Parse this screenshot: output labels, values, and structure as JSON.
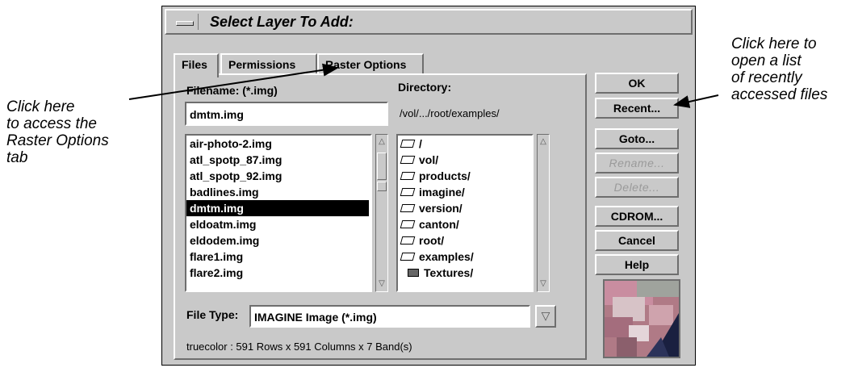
{
  "annotations": {
    "left_lines": [
      "Click here",
      "to access the",
      "Raster Options",
      "tab"
    ],
    "right_lines": [
      "Click here to",
      "open a list",
      "of recently",
      "accessed files"
    ]
  },
  "dialog": {
    "title": "Select Layer To Add:",
    "menu_icon": "window-menu-icon",
    "tabs": [
      "Files",
      "Permissions",
      "Raster Options"
    ],
    "active_tab": "Files",
    "filename_label": "Filename: (*.img)",
    "filename_value": "dmtm.img",
    "directory_label": "Directory:",
    "directory_path": "/vol/.../root/examples/",
    "files": [
      "air-photo-2.img",
      "atl_spotp_87.img",
      "atl_spotp_92.img",
      "badlines.img",
      "dmtm.img",
      "eldoatm.img",
      "eldodem.img",
      "flare1.img",
      "flare2.img"
    ],
    "selected_file": "dmtm.img",
    "directories": [
      {
        "name": "/",
        "icon": "open-folder-icon"
      },
      {
        "name": "vol/",
        "icon": "open-folder-icon"
      },
      {
        "name": "products/",
        "icon": "open-folder-icon"
      },
      {
        "name": "imagine/",
        "icon": "open-folder-icon"
      },
      {
        "name": "version/",
        "icon": "open-folder-icon"
      },
      {
        "name": "canton/",
        "icon": "open-folder-icon"
      },
      {
        "name": "root/",
        "icon": "open-folder-icon"
      },
      {
        "name": "examples/",
        "icon": "open-folder-icon"
      },
      {
        "name": "Textures/",
        "icon": "closed-folder-icon"
      }
    ],
    "file_type_label": "File Type:",
    "file_type_value": "IMAGINE Image (*.img)",
    "info": "truecolor : 591 Rows x 591 Columns x 7 Band(s)",
    "buttons": {
      "ok": "OK",
      "recent": "Recent...",
      "goto": "Goto...",
      "rename": "Rename...",
      "delete": "Delete...",
      "cdrom": "CDROM...",
      "cancel": "Cancel",
      "help": "Help"
    },
    "disabled_buttons": [
      "rename",
      "delete"
    ]
  }
}
